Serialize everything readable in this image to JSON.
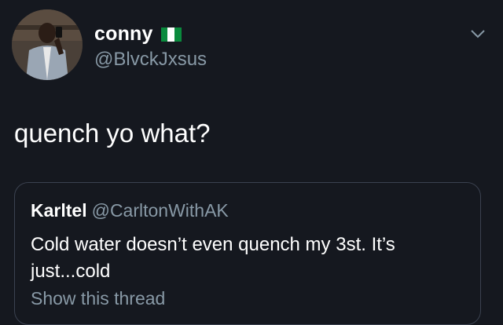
{
  "author": {
    "display_name": "conny",
    "handle": "@BlvckJxsus",
    "flag_icon": "nigeria-flag-icon",
    "flag_colors": [
      "#0a8a3d",
      "#ffffff",
      "#0a8a3d"
    ]
  },
  "tweet": {
    "text": "quench yo what?"
  },
  "quoted": {
    "display_name": "Karltel",
    "handle": "@CarltonWithAK",
    "text": "Cold water doesn’t even quench my 3st. It’s just...cold",
    "show_thread_label": "Show this thread"
  },
  "colors": {
    "background": "#15181f",
    "secondary_text": "#8899a6",
    "border": "#3b4250"
  }
}
